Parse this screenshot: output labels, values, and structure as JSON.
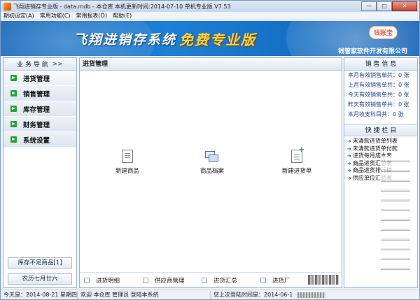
{
  "window": {
    "title": "飞翔进销存专业版 - data.mdb - 本仓库  本机更新时间:2014-07-10 单机专业版 V7.53",
    "minimize": "—",
    "maximize": "□",
    "close": "✕"
  },
  "menu": [
    "期初设定(A)",
    "常用功能(C)",
    "常用报表(D)",
    "帮助(E)"
  ],
  "banner": {
    "brand": "飞翔进销存系统",
    "slogan": "免费专业版",
    "badge": "钱账宝",
    "company": "钱管家软件开发有限公司"
  },
  "nav": {
    "header": "业 务 导 航",
    "collapse": ">>",
    "items": [
      "进货管理",
      "销售管理",
      "库存管理",
      "财务管理",
      "系统设置"
    ],
    "bottom_buttons": [
      "库存不足商品[1]",
      "农历七月廿六"
    ]
  },
  "main": {
    "title": "进货管理",
    "quick_actions": [
      {
        "label": "新建商品",
        "icon": "document-icon"
      },
      {
        "label": "商品档案",
        "icon": "cards-icon"
      },
      {
        "label": "新建进货单",
        "icon": "document-add-icon"
      }
    ],
    "bottom_links": [
      "进货明细",
      "供应商管理",
      "进货汇总",
      "进货厂"
    ]
  },
  "sales_info": {
    "title": "销 售 信 息",
    "rows": [
      "本月有效销售单共：0 张",
      "上月有效销售单共：0 张",
      "今天有效销售单共：0 张",
      "昨天有效销售单共：0 张",
      "本月收支科目共：0 张"
    ]
  },
  "quick_panel": {
    "title": "快 捷 栏 目",
    "items": [
      "未清款进货单列表",
      "未清款进货单付款",
      "进货每月成本表",
      "商品进货汇总表",
      "商品进货排行榜",
      "供应单位汇总表"
    ]
  },
  "status": {
    "today": "今天是：2014-08-21 星期四",
    "welcome": "欢迎 本仓库 管理员  登陆本系统",
    "last_login": "您上次登陆时间是：2014-06-1"
  },
  "colors": {
    "banner": "#1a78cf",
    "nav_icon": "#22a33a",
    "stat_text": "#1c3f8e",
    "slogan": "#ffd33a"
  }
}
